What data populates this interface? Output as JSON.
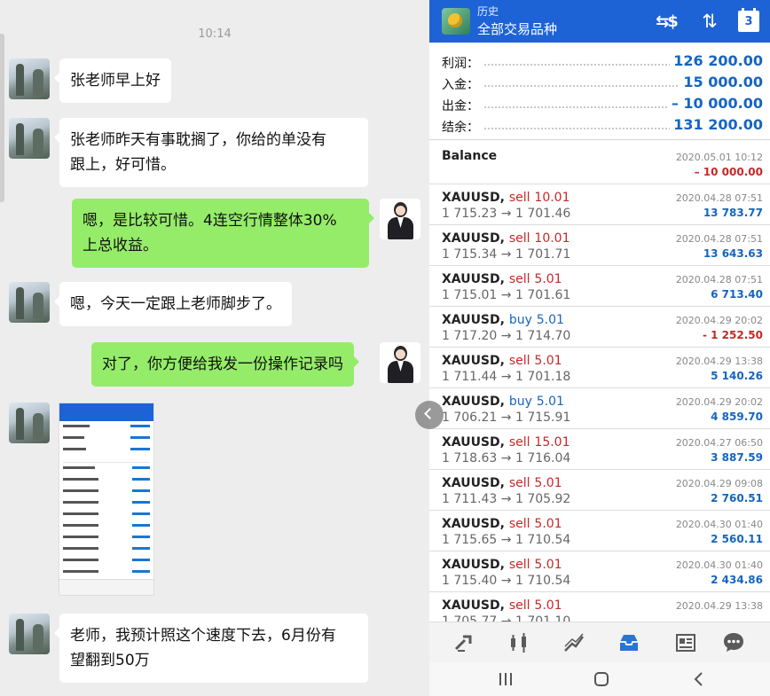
{
  "chat": {
    "time": "10:14",
    "messages": [
      {
        "side": "in",
        "text": "张老师早上好"
      },
      {
        "side": "in",
        "text_line1": "张老师昨天有事耽搁了，你给的单没有",
        "text_line2": "跟上，好可惜。"
      },
      {
        "side": "out",
        "text_line1": "嗯，是比较可惜。4连空行情整体30%",
        "text_line2": "上总收益。"
      },
      {
        "side": "in",
        "text": "嗯，今天一定跟上老师脚步了。"
      },
      {
        "side": "out",
        "text": "对了，你方便给我发一份操作记录吗"
      },
      {
        "side": "in",
        "type": "image"
      },
      {
        "side": "in",
        "text_line1": "老师，我预计照这个速度下去，6月份有",
        "text_line2": "望翻到50万"
      }
    ]
  },
  "app": {
    "header": {
      "subtitle": "历史",
      "title": "全部交易品种",
      "period_badge": "3"
    },
    "summary": {
      "profit": {
        "label": "利润：",
        "value": "126 200.00"
      },
      "deposit": {
        "label": "入金：",
        "value": "15 000.00"
      },
      "withdrawal": {
        "label": "出金：",
        "value": "– 10 000.00"
      },
      "balance": {
        "label": "结余：",
        "value": "131 200.00"
      }
    },
    "balance_entry": {
      "label": "Balance",
      "time": "2020.05.01 10:12",
      "amount": "– 10 000.00"
    },
    "deals": [
      {
        "symbol": "XAUUSD,",
        "action": "sell",
        "volume": "10.01",
        "prices": "1 715.23 → 1 701.46",
        "time": "2020.04.28 07:51",
        "profit": "13 783.77"
      },
      {
        "symbol": "XAUUSD,",
        "action": "sell",
        "volume": "10.01",
        "prices": "1 715.34 → 1 701.71",
        "time": "2020.04.28 07:51",
        "profit": "13 643.63"
      },
      {
        "symbol": "XAUUSD,",
        "action": "sell",
        "volume": "5.01",
        "prices": "1 715.01 → 1 701.61",
        "time": "2020.04.28 07:51",
        "profit": "6 713.40"
      },
      {
        "symbol": "XAUUSD,",
        "action": "buy",
        "volume": "5.01",
        "prices": "1 717.20 → 1 714.70",
        "time": "2020.04.29 20:02",
        "profit": "- 1 252.50"
      },
      {
        "symbol": "XAUUSD,",
        "action": "sell",
        "volume": "5.01",
        "prices": "1 711.44 → 1 701.18",
        "time": "2020.04.29 13:38",
        "profit": "5 140.26"
      },
      {
        "symbol": "XAUUSD,",
        "action": "buy",
        "volume": "5.01",
        "prices": "1 706.21 → 1 715.91",
        "time": "2020.04.29 20:02",
        "profit": "4 859.70"
      },
      {
        "symbol": "XAUUSD,",
        "action": "sell",
        "volume": "15.01",
        "prices": "1 718.63 → 1 716.04",
        "time": "2020.04.27 06:50",
        "profit": "3 887.59"
      },
      {
        "symbol": "XAUUSD,",
        "action": "sell",
        "volume": "5.01",
        "prices": "1 711.43 → 1 705.92",
        "time": "2020.04.29 09:08",
        "profit": "2 760.51"
      },
      {
        "symbol": "XAUUSD,",
        "action": "sell",
        "volume": "5.01",
        "prices": "1 715.65 → 1 710.54",
        "time": "2020.04.30 01:40",
        "profit": "2 560.11"
      },
      {
        "symbol": "XAUUSD,",
        "action": "sell",
        "volume": "5.01",
        "prices": "1 715.40 → 1 710.54",
        "time": "2020.04.30 01:40",
        "profit": "2 434.86"
      },
      {
        "symbol": "XAUUSD,",
        "action": "sell",
        "volume": "5.01",
        "prices": "1 705.77 → 1 701.10",
        "time": "2020.04.29 13:38",
        "profit": ""
      }
    ],
    "bottom_nav": [
      "quotes-icon",
      "chart-icon",
      "trade-icon",
      "history-icon",
      "news-icon",
      "chat-icon"
    ],
    "colors": {
      "header": "#1e63d6",
      "sell": "#c62828",
      "buy": "#1565c0",
      "profit": "#1565c0",
      "loss": "#c62828",
      "chat_out": "#95ec69"
    }
  }
}
